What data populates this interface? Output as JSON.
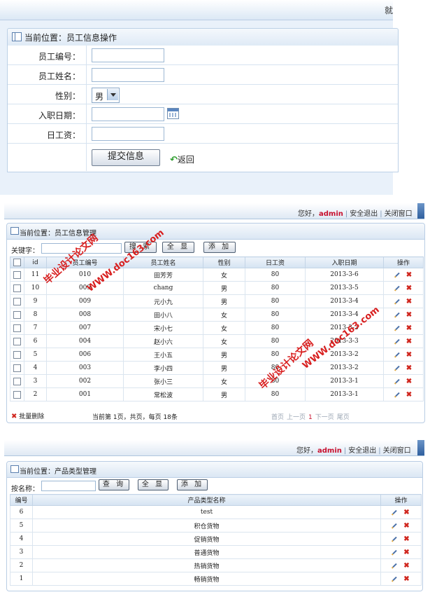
{
  "panel1": {
    "edge_char": "就",
    "breadcrumb": "当前位置：员工信息操作",
    "fields": {
      "emp_no_label": "员工编号：",
      "emp_name_label": "员工姓名：",
      "gender_label": "性别：",
      "gender_value": "男",
      "hire_date_label": "入职日期：",
      "wage_label": "日工资："
    },
    "submit_label": "提交信息",
    "back_label": "返回"
  },
  "header": {
    "greeting": "您好，",
    "user": "admin",
    "logout": "安全退出",
    "close": "关闭窗口"
  },
  "panel2": {
    "breadcrumb": "当前位置：员工信息管理",
    "keyword_label": "关键字：",
    "search_label": "搜 索",
    "showall_label": "全 显",
    "add_label": "添 加",
    "columns": [
      "id",
      "员工编号",
      "员工姓名",
      "性别",
      "日工资",
      "入职日期",
      "操作"
    ],
    "rows": [
      [
        "11",
        "010",
        "田芳芳",
        "女",
        "80",
        "2013-3-6"
      ],
      [
        "10",
        "009",
        "chang",
        "男",
        "80",
        "2013-3-5"
      ],
      [
        "9",
        "009",
        "元小九",
        "男",
        "80",
        "2013-3-4"
      ],
      [
        "8",
        "008",
        "田小八",
        "女",
        "80",
        "2013-3-4"
      ],
      [
        "7",
        "007",
        "宋小七",
        "女",
        "80",
        "2013-3-3"
      ],
      [
        "6",
        "004",
        "赵小六",
        "女",
        "80",
        "2013-3-3"
      ],
      [
        "5",
        "006",
        "王小五",
        "男",
        "80",
        "2013-3-2"
      ],
      [
        "4",
        "003",
        "李小四",
        "男",
        "80",
        "2013-3-2"
      ],
      [
        "3",
        "002",
        "张小三",
        "女",
        "80",
        "2013-3-1"
      ],
      [
        "2",
        "001",
        "常松波",
        "男",
        "80",
        "2013-3-1"
      ]
    ],
    "batch_delete": "批量删除",
    "page_info": "当前第 1页，共页，每页 18条",
    "pager": {
      "first": "首页",
      "prev": "上一页",
      "current": "1",
      "next": "下一页",
      "last": "尾页"
    }
  },
  "panel3": {
    "breadcrumb": "当前位置：产品类型管理",
    "name_label": "按名称：",
    "search_label": "查 询",
    "showall_label": "全 显",
    "add_label": "添 加",
    "columns": [
      "编号",
      "产品类型名称",
      "操作"
    ],
    "rows": [
      [
        "6",
        "test"
      ],
      [
        "5",
        "积仓货物"
      ],
      [
        "4",
        "促销货物"
      ],
      [
        "3",
        "普通货物"
      ],
      [
        "2",
        "热销货物"
      ],
      [
        "1",
        "畅销货物"
      ]
    ]
  },
  "watermarks": [
    "毕业设计论文网",
    "WWW.doc163.com",
    "毕业设计论文网",
    "WWW.doc163.com"
  ],
  "colors": {
    "accent": "#c8102e",
    "border": "#b9cde4",
    "header_top": "#dfe9f4"
  }
}
